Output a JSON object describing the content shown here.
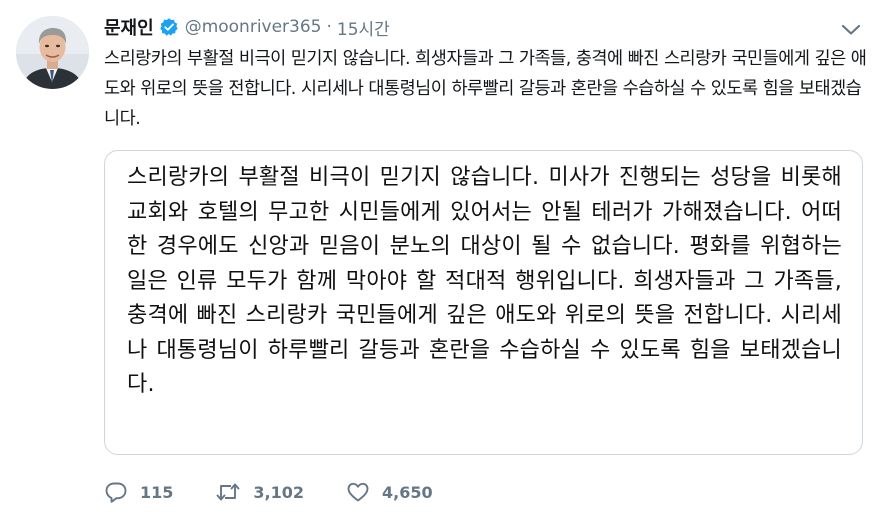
{
  "tweet": {
    "author_name": "문재인",
    "handle": "@moonriver365",
    "separator": "·",
    "time": "15시간",
    "text": "스리랑카의 부활절 비극이 믿기지 않습니다. 희생자들과 그 가족들, 충격에 빠진 스리랑카 국민들에게 깊은 애도와 위로의 뜻을 전합니다. 시리세나 대통령님이 하루빨리 갈등과 혼란을 수습하실 수 있도록 힘을 보태겠습니다.",
    "image_text": "스리랑카의 부활절 비극이 믿기지 않습니다. 미사가 진행되는 성당을 비롯해 교회와 호텔의 무고한 시민들에게 있어서는 안될 테러가 가해졌습니다. 어떠한 경우에도 신앙과 믿음이 분노의 대상이 될 수 없습니다. 평화를 위협하는 일은 인류 모두가 함께 막아야 할 적대적 행위입니다. 희생자들과 그 가족들, 충격에 빠진 스리랑카 국민들에게 깊은 애도와 위로의 뜻을 전합니다. 시리세나 대통령님이 하루빨리 갈등과 혼란을 수습하실 수 있도록 힘을 보태겠습니다.",
    "replies": "115",
    "retweets": "3,102",
    "likes": "4,650"
  },
  "icons": {
    "verified": "verified-badge-icon",
    "caret": "chevron-down-icon",
    "reply": "reply-icon",
    "retweet": "retweet-icon",
    "like": "heart-icon"
  },
  "colors": {
    "verified": "#1da1f2",
    "secondary_text": "#657786",
    "border": "#ccd6dd"
  }
}
